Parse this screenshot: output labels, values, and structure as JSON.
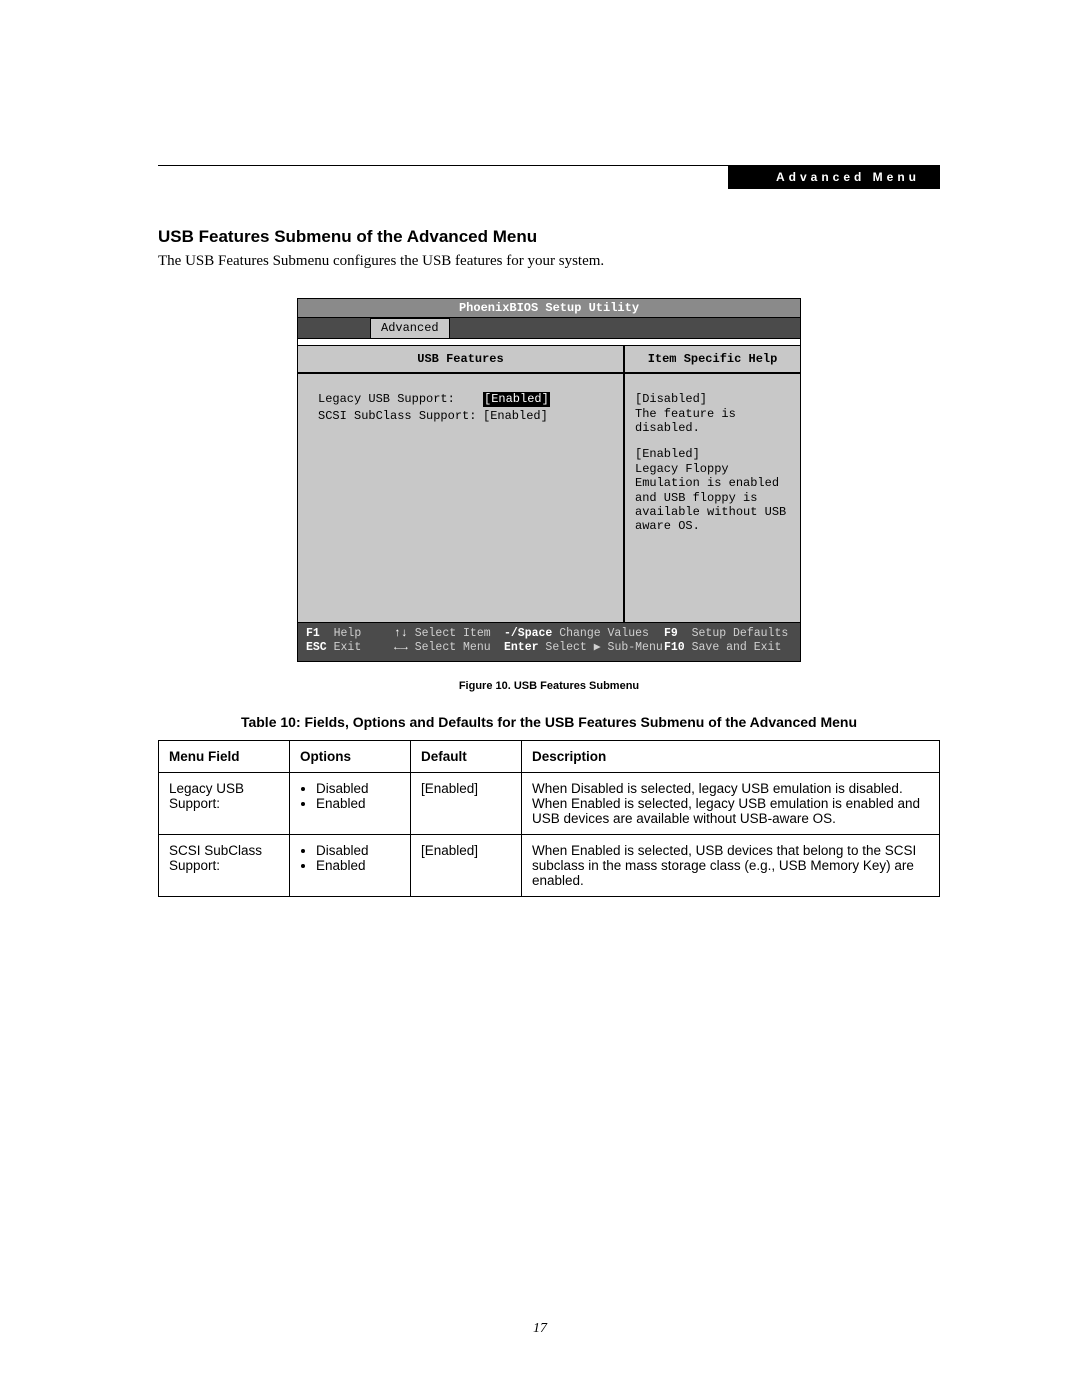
{
  "header": {
    "section": "Advanced Menu"
  },
  "page_number": "17",
  "section_title": "USB Features Submenu of the Advanced Menu",
  "intro": "The USB Features Submenu configures the USB features for your system.",
  "bios": {
    "title": "PhoenixBIOS Setup Utility",
    "active_tab": "Advanced",
    "left_title": "USB Features",
    "right_title": "Item Specific Help",
    "settings": [
      {
        "label": "Legacy USB Support:",
        "value": "[Enabled]",
        "highlight": true
      },
      {
        "label": "SCSI SubClass Support:",
        "value": "[Enabled]",
        "highlight": false
      }
    ],
    "help": {
      "disabled_label": "[Disabled]",
      "disabled_text": "The feature is disabled.",
      "enabled_label": "[Enabled]",
      "enabled_text": "Legacy Floppy Emulation is enabled and USB floppy is available without USB aware OS."
    },
    "footer": {
      "row1": [
        {
          "key": "F1",
          "txt": "Help"
        },
        {
          "key": "↑↓",
          "txt": "Select Item"
        },
        {
          "key": "-/Space",
          "txt": "Change Values"
        },
        {
          "key": "F9",
          "txt": "Setup Defaults"
        }
      ],
      "row2": [
        {
          "key": "ESC",
          "txt": "Exit"
        },
        {
          "key": "←→",
          "txt": "Select Menu"
        },
        {
          "key": "Enter",
          "txt": "Select ▶ Sub-Menu"
        },
        {
          "key": "F10",
          "txt": "Save and Exit"
        }
      ]
    }
  },
  "figure_caption": "Figure 10.  USB Features Submenu",
  "table_caption": "Table 10: Fields, Options and Defaults for the USB Features Submenu of the Advanced Menu",
  "table": {
    "headers": {
      "field": "Menu Field",
      "options": "Options",
      "default": "Default",
      "desc": "Description"
    },
    "rows": [
      {
        "field": "Legacy USB Support:",
        "options": [
          "Disabled",
          "Enabled"
        ],
        "default": "[Enabled]",
        "desc": "When Disabled is selected, legacy USB emulation is disabled. When Enabled is selected, legacy USB emulation is enabled and USB devices are available without USB-aware OS."
      },
      {
        "field": "SCSI SubClass Support:",
        "options": [
          "Disabled",
          "Enabled"
        ],
        "default": "[Enabled]",
        "desc": "When Enabled is selected, USB devices that belong to the SCSI subclass in the mass storage class (e.g., USB Memory Key) are enabled."
      }
    ]
  }
}
